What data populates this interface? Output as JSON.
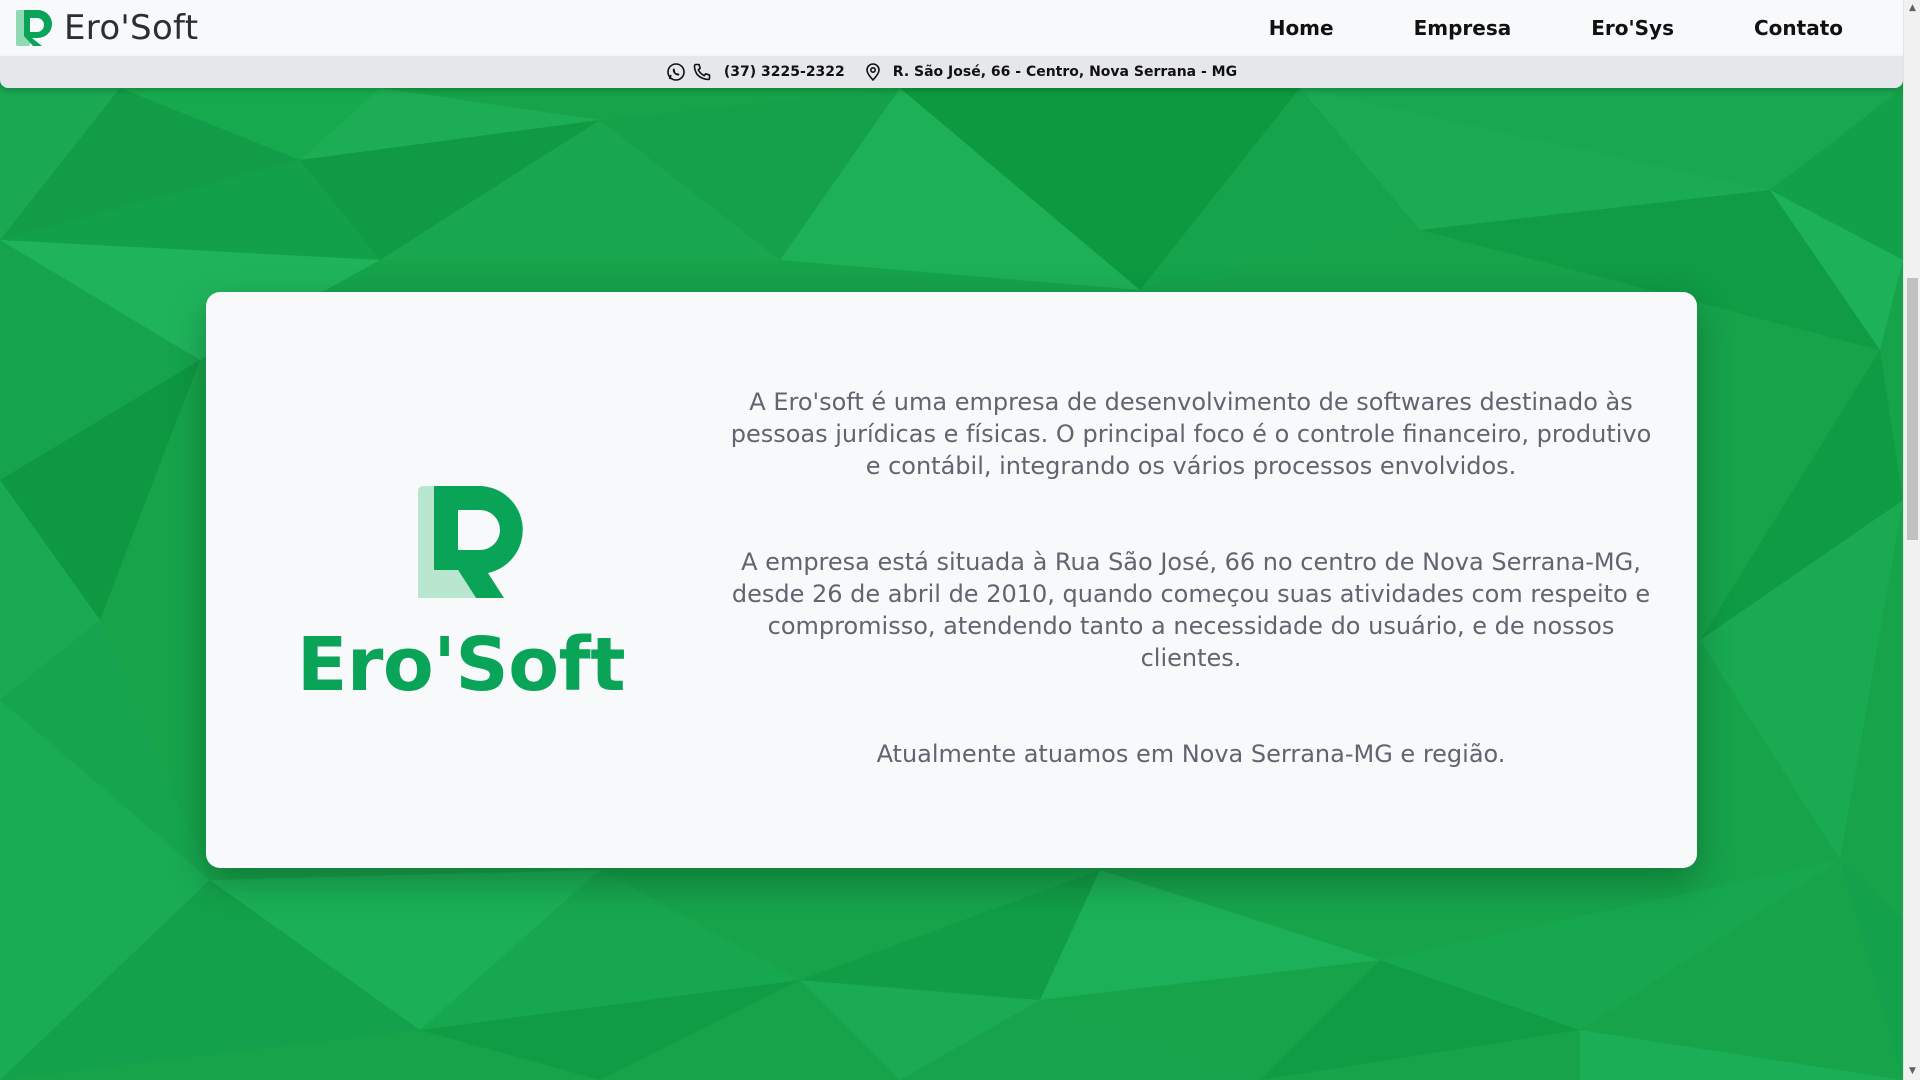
{
  "colors": {
    "brand_green": "#0aa458",
    "background_green": "#16a34a",
    "header_bg": "#f8f9fa",
    "infobar_bg": "#e5e7eb",
    "card_bg": "#f8f9fa",
    "body_text": "#5f6670"
  },
  "header": {
    "logo_icon": "erosoft-r-logo-icon",
    "brand_name": "Ero'Soft",
    "nav": [
      {
        "label": "Home"
      },
      {
        "label": "Empresa"
      },
      {
        "label": "Ero'Sys"
      },
      {
        "label": "Contato"
      }
    ]
  },
  "infobar": {
    "whatsapp_icon": "whatsapp-icon",
    "phone_icon": "phone-icon",
    "phone": "(37) 3225-2322",
    "location_icon": "location-pin-icon",
    "address": "R. São José, 66 - Centro, Nova Serrana - MG"
  },
  "about": {
    "logo_icon": "erosoft-r-logo-icon",
    "logo_text": "Ero'Soft",
    "paragraphs": [
      "A Ero'soft é uma empresa de desenvolvimento de softwares destinado às pessoas jurídicas e físicas. O principal foco é o controle financeiro, produtivo e contábil, integrando os vários processos envolvidos.",
      "A empresa está situada à Rua São José, 66 no centro de Nova Serrana-MG, desde 26 de abril de 2010, quando começou suas atividades com respeito e compromisso, atendendo tanto a necessidade do usuário, e de nossos clientes.",
      "Atualmente atuamos em Nova Serrana-MG e região."
    ]
  }
}
